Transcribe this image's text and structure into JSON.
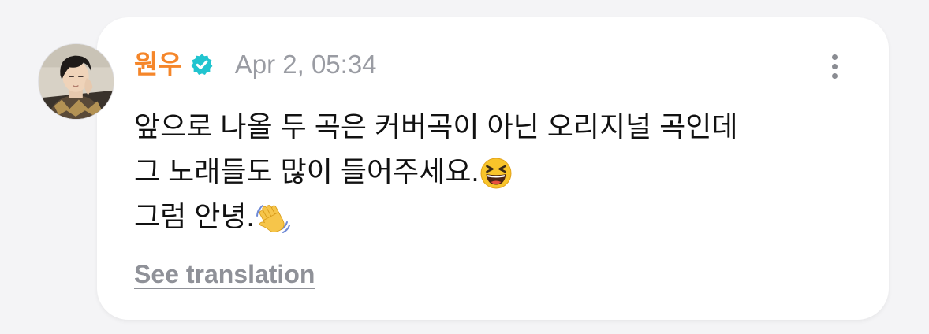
{
  "post": {
    "author": "원우",
    "author_color": "#f5862a",
    "verified_icon": "verified-badge-icon",
    "verified_color": "#21c4cf",
    "timestamp": "Apr 2, 05:34",
    "more_icon": "vertical-ellipsis-icon",
    "lines": [
      "앞으로 나올 두 곡은 커버곡이 아닌 오리지널 곡인데",
      "그 노래들도 많이 들어주세요.",
      "그럼 안녕."
    ],
    "line2_emoji": "grinning-squinting-face-emoji",
    "line3_emoji": "waving-hand-emoji",
    "see_translation": "See translation"
  }
}
